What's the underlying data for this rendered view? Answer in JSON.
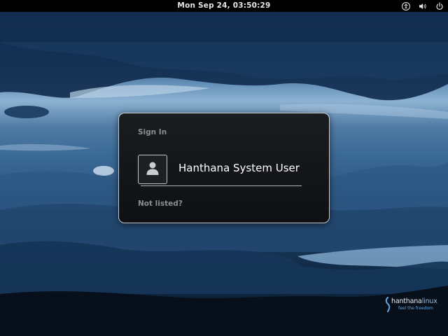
{
  "topbar": {
    "clock": "Mon Sep 24, 03:50:29",
    "icons": [
      "accessibility-icon",
      "volume-icon",
      "power-icon"
    ]
  },
  "login_dialog": {
    "title": "Sign In",
    "user_name": "Hanthana System User",
    "avatar_icon": "user-silhouette-icon",
    "not_listed": "Not listed?"
  },
  "brand": {
    "name_bold": "hanthana",
    "name_light": "linux",
    "tagline": "feel the freedom"
  },
  "colors": {
    "topbar_bg": "#000000",
    "dialog_bg": "#141719",
    "dialog_border": "#c9cbcc",
    "muted_text": "#8b8e91",
    "brand_accent": "#5fa7e6"
  }
}
